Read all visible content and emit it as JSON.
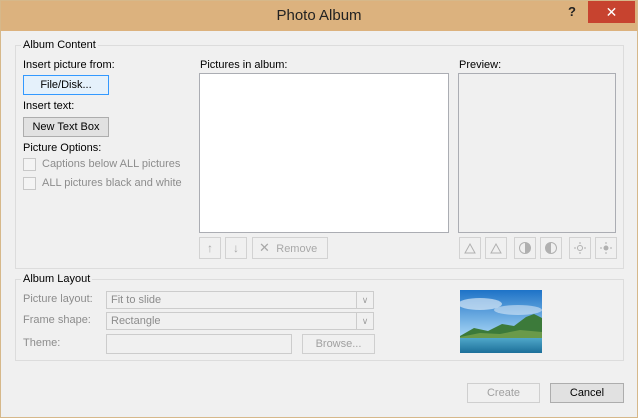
{
  "window": {
    "title": "Photo Album",
    "help_label": "?",
    "close_label": "✕"
  },
  "album_content": {
    "group_label": "Album Content",
    "insert_picture_label": "Insert picture from:",
    "file_disk_button": "File/Disk...",
    "insert_text_label": "Insert text:",
    "new_text_box_button": "New Text Box",
    "picture_options_label": "Picture Options:",
    "captions_checkbox": "Captions below ALL pictures",
    "black_white_checkbox": "ALL pictures black and white",
    "pictures_in_album_label": "Pictures in album:",
    "remove_button": "Remove",
    "preview_label": "Preview:"
  },
  "album_layout": {
    "group_label": "Album Layout",
    "picture_layout_label": "Picture layout:",
    "picture_layout_value": "Fit to slide",
    "frame_shape_label": "Frame shape:",
    "frame_shape_value": "Rectangle",
    "theme_label": "Theme:",
    "theme_value": "",
    "browse_button": "Browse..."
  },
  "footer": {
    "create_button": "Create",
    "cancel_button": "Cancel"
  },
  "icons": {
    "move_up": "↑",
    "move_down": "↓",
    "remove": "✕",
    "chevron": "∨"
  },
  "colors": {
    "titlebar": "#dcb27e",
    "close": "#c7432f",
    "focus": "#3399ff"
  }
}
